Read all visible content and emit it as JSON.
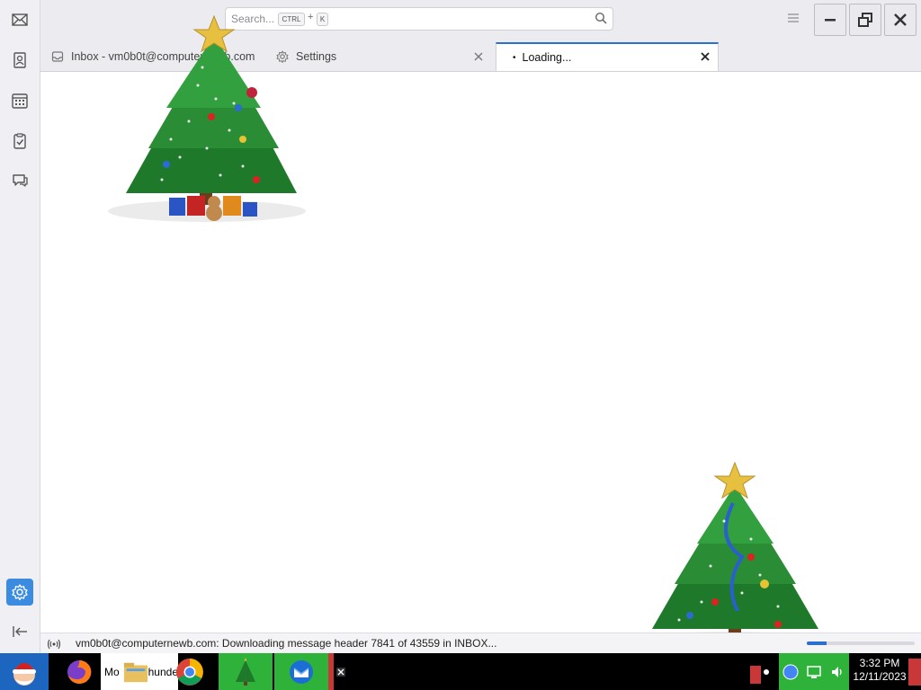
{
  "toolbar": {
    "search_placeholder": "Search...",
    "kbd_ctrl": "CTRL",
    "kbd_plus": "+",
    "kbd_k": "K"
  },
  "tabs": [
    {
      "label": "Inbox - vm0b0t@computernewb.com"
    },
    {
      "label": "Settings"
    },
    {
      "label": "Loading..."
    }
  ],
  "status": {
    "message": "vm0b0t@computernewb.com: Downloading message header 7841 of 43559 in INBOX...",
    "progress_fraction": 0.18
  },
  "taskbar": {
    "thunderbird_label": "Mo",
    "thunderbird_label2": "hunde",
    "time": "3:32 PM",
    "date": "12/11/2023"
  },
  "colors": {
    "accent": "#2a70d0",
    "taskbar": "#000000",
    "tree_green": "#1e7a2a"
  },
  "icons": {
    "spaces": [
      "mail-icon",
      "address-book-icon",
      "calendar-icon",
      "tasks-icon",
      "chat-icon",
      "settings-icon",
      "collapse-icon"
    ]
  }
}
